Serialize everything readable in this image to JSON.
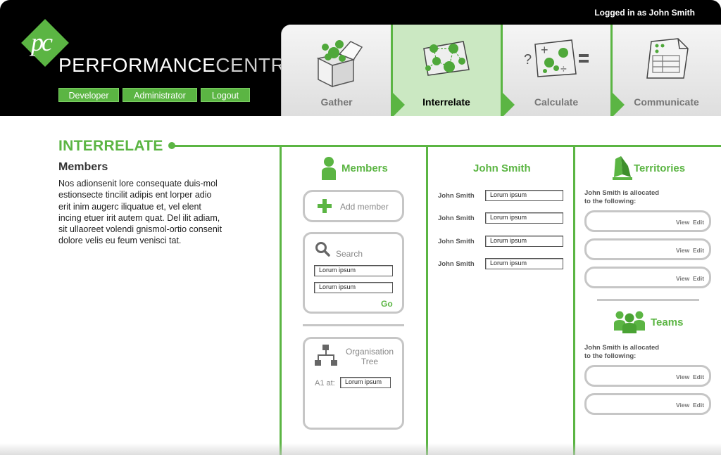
{
  "header": {
    "logged_in": "Logged in as John Smith",
    "logo_letters": "pc",
    "brand_part1": "PERFORMANCE",
    "brand_part2": "CENTRE",
    "buttons": {
      "developer": "Developer",
      "administrator": "Administrator",
      "logout": "Logout"
    }
  },
  "tabs": [
    {
      "label": "Gather",
      "icon": "box-icon",
      "active": false
    },
    {
      "label": "Interrelate",
      "icon": "network-icon",
      "active": true
    },
    {
      "label": "Calculate",
      "icon": "calculator-icon",
      "active": false
    },
    {
      "label": "Communicate",
      "icon": "document-icon",
      "active": false
    }
  ],
  "main": {
    "section_title": "INTERRELATE",
    "left": {
      "heading": "Members",
      "text": "Nos adionsenit lore consequate duis-mol estionsecte tincilit adipis ent lorper adio erit inim augerc iliquatue et, vel elent incing etuer irit autem quat. Del ilit adiam, sit ullaoreet volendi gnismol-ortio consenit dolore velis eu feum venisci tat."
    },
    "members": {
      "heading": "Members",
      "add_member": "Add member",
      "search": {
        "label": "Search",
        "field1": "Lorum ipsum",
        "field2": "Lorum ipsum",
        "go": "Go"
      },
      "org_tree": {
        "label_line1": "Organisation",
        "label_line2": "Tree",
        "a1_label": "A1 at:",
        "a1_value": "Lorum ipsum"
      }
    },
    "john": {
      "heading": "John Smith",
      "rows": [
        {
          "label": "John Smith",
          "value": "Lorum ipsum"
        },
        {
          "label": "John Smith",
          "value": "Lorum ipsum"
        },
        {
          "label": "John Smith",
          "value": "Lorum ipsum"
        },
        {
          "label": "John Smith",
          "value": "Lorum ipsum"
        }
      ]
    },
    "territories": {
      "heading": "Territories",
      "allocated_line1": "John Smith is allocated",
      "allocated_line2": "to the following:",
      "view": "View",
      "edit": "Edit"
    },
    "teams": {
      "heading": "Teams",
      "allocated_line1": "John Smith is allocated",
      "allocated_line2": "to the following:",
      "view": "View",
      "edit": "Edit"
    }
  },
  "colors": {
    "accent": "#5bb543",
    "header_bg": "#000000",
    "border_gray": "#c6c6c6"
  }
}
